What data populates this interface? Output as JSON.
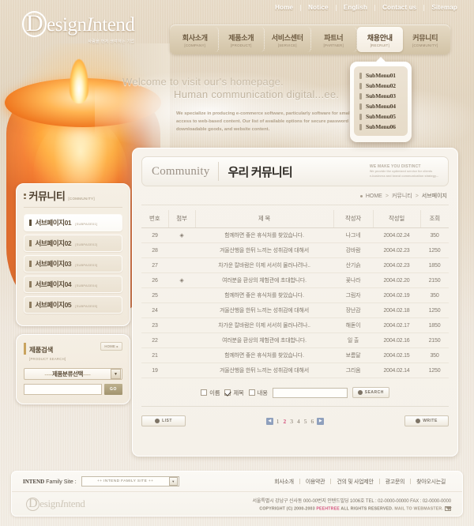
{
  "site": {
    "logo_cap": "D",
    "logo_rest": "esign",
    "logo_accent": "I",
    "logo_tail": "ntend",
    "logo_tagline": "사람을 먼저 생각하는 기업"
  },
  "utility_nav": [
    {
      "label": "Home"
    },
    {
      "label": "Notice"
    },
    {
      "label": "English"
    },
    {
      "label": "Contact us"
    },
    {
      "label": "Sitemap"
    }
  ],
  "main_nav": [
    {
      "ko": "회사소개",
      "en": "[COMPANY]",
      "active": false
    },
    {
      "ko": "제품소개",
      "en": "[PRODUCT]",
      "active": false
    },
    {
      "ko": "서비스센터",
      "en": "[SERVICE]",
      "active": false
    },
    {
      "ko": "파트너",
      "en": "[PARTNER]",
      "active": false
    },
    {
      "ko": "채용안내",
      "en": "[RECRUIT]",
      "active": true
    },
    {
      "ko": "커뮤니티",
      "en": "[COMMUNITY]",
      "active": false
    }
  ],
  "dropdown": {
    "items": [
      {
        "label": "SubMenu01"
      },
      {
        "label": "SubMenu02"
      },
      {
        "label": "SubMenu03"
      },
      {
        "label": "SubMenu04"
      },
      {
        "label": "SubMenu05"
      },
      {
        "label": "SubMenu06"
      }
    ]
  },
  "hero": {
    "line1_a": "Welcome to visit our's homepage.",
    "line2": "Human communication digital...ee.",
    "body": "We specialize in producing e-commerce software, particularly software for small digital good (e-goods) and access to web-based content. Our list of available options for secure password protection of web content, downloadable goods, and website content."
  },
  "sidebar": {
    "title_ko": "커뮤니티",
    "title_en": "[COMMUNITY]",
    "items": [
      {
        "ko": "서브페이지01",
        "en": "[SUBPAGE01]",
        "active": true
      },
      {
        "ko": "서브페이지02",
        "en": "[SUBPAGE02]",
        "active": false
      },
      {
        "ko": "서브페이지03",
        "en": "[SUBPAGE03]",
        "active": false
      },
      {
        "ko": "서브페이지04",
        "en": "[SUBPAGE04]",
        "active": false
      },
      {
        "ko": "서브페이지05",
        "en": "[SUBPAGE05]",
        "active": false
      }
    ],
    "product_search": {
      "title_ko": "제품검색",
      "title_en": "[PRODUCT SEARCH]",
      "home_label": "HOME ▸",
      "select_value": "제품분류선택",
      "select_dec_left": "▪▪▪▪▪▪",
      "select_dec_right": "▪▪▪▪▪▪",
      "input_value": "",
      "go_label": "GO"
    }
  },
  "page_header": {
    "title_en": "Community",
    "title_ko": "우리 커뮤니티",
    "slogan_title": "WE MAKE YOU DISTINCT",
    "slogan_line1": "We provide the optimized service for clients",
    "slogan_line2": "e-business and brand communication strategy..."
  },
  "breadcrumb": {
    "home": "HOME",
    "sep": ">",
    "section": "커뮤니티",
    "current": "서브페이지"
  },
  "board": {
    "columns": [
      "번호",
      "첨부",
      "제  목",
      "작성자",
      "작성일",
      "조회"
    ],
    "rows": [
      {
        "no": "29",
        "attach": "◈",
        "subject": "함께하면 좋은 휴식처를 찾았습니다.",
        "writer": "나그네",
        "date": "2004.02.24",
        "hits": "350"
      },
      {
        "no": "28",
        "attach": "",
        "subject": "겨울산행을 한뒤 느끼는 성취감에 대해서",
        "writer": "강바람",
        "date": "2004.02.23",
        "hits": "1250"
      },
      {
        "no": "27",
        "attach": "",
        "subject": "차가운 칼바람은 이제 서서히 물러나려나..",
        "writer": "산기슭",
        "date": "2004.02.23",
        "hits": "1850"
      },
      {
        "no": "26",
        "attach": "◈",
        "subject": "여러분을 환상의 체험관에 초대합니다.",
        "writer": "꽃나라",
        "date": "2004.02.20",
        "hits": "2150"
      },
      {
        "no": "25",
        "attach": "",
        "subject": "함께하면 좋은 휴식처를 찾았습니다.",
        "writer": "그림자",
        "date": "2004.02.19",
        "hits": "350"
      },
      {
        "no": "24",
        "attach": "",
        "subject": "겨울산행을 한뒤 느끼는 성취감에 대해서",
        "writer": "장난감",
        "date": "2004.02.18",
        "hits": "1250"
      },
      {
        "no": "23",
        "attach": "",
        "subject": "차가운 칼바람은 이제 서서히 물러나려나..",
        "writer": "해돋이",
        "date": "2004.02.17",
        "hits": "1850"
      },
      {
        "no": "22",
        "attach": "",
        "subject": "여러분을 환상의 체험관에 초대합니다.",
        "writer": "일  출",
        "date": "2004.02.16",
        "hits": "2150"
      },
      {
        "no": "21",
        "attach": "",
        "subject": "함께하면 좋은 휴식처를 찾았습니다.",
        "writer": "보름달",
        "date": "2004.02.15",
        "hits": "350"
      },
      {
        "no": "19",
        "attach": "",
        "subject": "겨울산행을 한뒤 느끼는 성취감에 대해서",
        "writer": "그리움",
        "date": "2004.02.14",
        "hits": "1250"
      }
    ]
  },
  "search": {
    "options": [
      {
        "label": "이름",
        "checked": false
      },
      {
        "label": "제목",
        "checked": true
      },
      {
        "label": "내용",
        "checked": false
      }
    ],
    "input_value": "",
    "button_label": "SEARCH"
  },
  "actions": {
    "list_label": "LIST",
    "write_label": "WRITE"
  },
  "pagination": {
    "prev": "◀",
    "next": "▶",
    "pages": [
      "1",
      "2",
      "3",
      "4",
      "5",
      "6"
    ],
    "current": "2"
  },
  "footer": {
    "family_label_b": "INTEND",
    "family_label_r": " Family Site :",
    "family_select": "++ INTEND FAMILY SITE ++",
    "links": [
      {
        "label": "회사소개"
      },
      {
        "label": "이용약관"
      },
      {
        "label": "건의 및 사업제안"
      },
      {
        "label": "광고문의"
      },
      {
        "label": "찾아오시는길"
      }
    ],
    "address": "서울특별시 강남구 신사동 000-00번지 인텐드빌딩 1006호  TEL : 02-0000-00000  FAX : 02-0000-0000",
    "copyright_pre": "COPYRIGHT (C) 2000-2003 ",
    "copyright_brand": "PEEHTREE",
    "copyright_post": " ALL RIGHTS RESERVED.",
    "mail_to": " MAIL TO WEBMASTER."
  },
  "colors": {
    "accent_pink": "#d4547e",
    "nav_text": "#6d5a40",
    "panel_bg": "#f7f3ec",
    "candle_orange": "#f2681d"
  }
}
